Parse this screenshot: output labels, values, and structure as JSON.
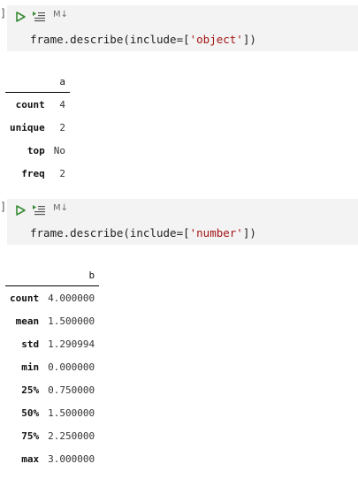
{
  "cells": [
    {
      "bracket": "]",
      "md_label": "M↓",
      "code": {
        "prefix": "frame.describe(include=[",
        "string": "'object'",
        "suffix": "])"
      },
      "output": {
        "columns": [
          "a"
        ],
        "rows": [
          {
            "label": "count",
            "value": "4"
          },
          {
            "label": "unique",
            "value": "2"
          },
          {
            "label": "top",
            "value": "No"
          },
          {
            "label": "freq",
            "value": "2"
          }
        ]
      }
    },
    {
      "bracket": "]",
      "md_label": "M↓",
      "code": {
        "prefix": "frame.describe(include=[",
        "string": "'number'",
        "suffix": "])"
      },
      "output": {
        "columns": [
          "b"
        ],
        "rows": [
          {
            "label": "count",
            "value": "4.000000"
          },
          {
            "label": "mean",
            "value": "1.500000"
          },
          {
            "label": "std",
            "value": "1.290994"
          },
          {
            "label": "min",
            "value": "0.000000"
          },
          {
            "label": "25%",
            "value": "0.750000"
          },
          {
            "label": "50%",
            "value": "1.500000"
          },
          {
            "label": "75%",
            "value": "2.250000"
          },
          {
            "label": "max",
            "value": "3.000000"
          }
        ]
      }
    }
  ],
  "colors": {
    "run_icon": "#388a34",
    "string": "#a31515",
    "cell_bg": "#f3f3f3"
  },
  "icons": {
    "run": "play-icon",
    "execute_above": "execute-above-icon"
  }
}
